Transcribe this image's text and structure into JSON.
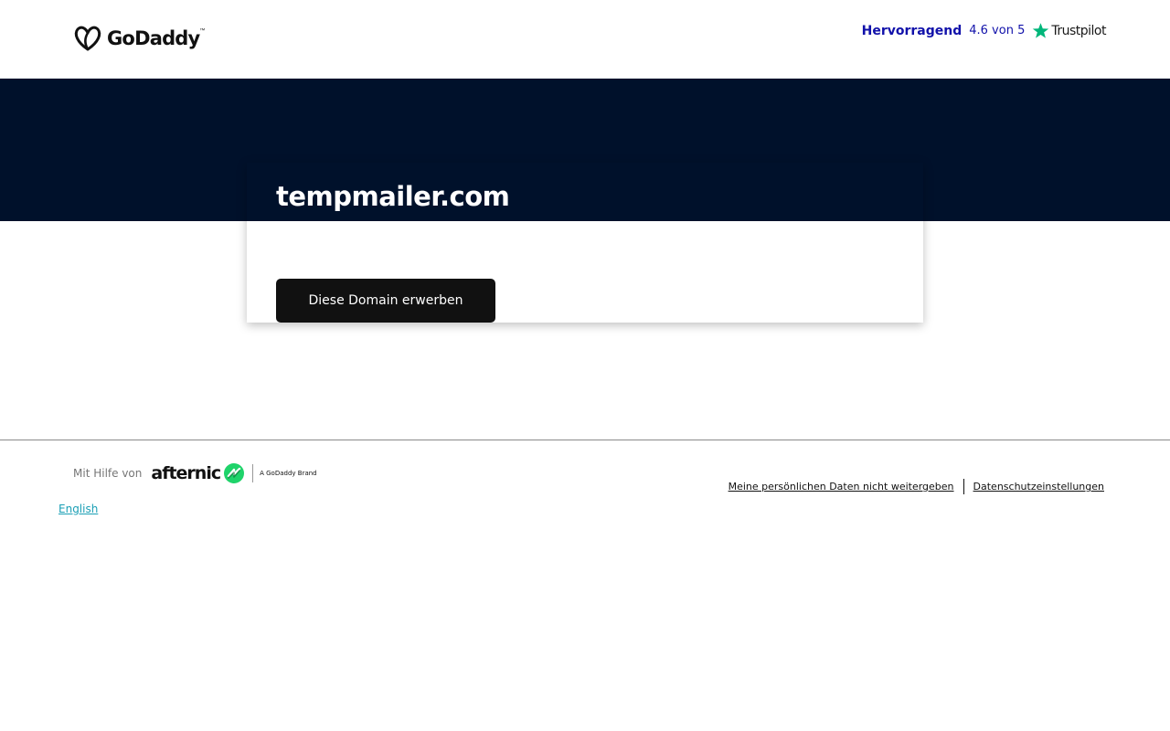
{
  "header": {
    "logo_text": "GoDaddy",
    "logo_tm": "™",
    "trustpilot": {
      "rating_label": "Hervorragend",
      "score_text": "4.6 von 5",
      "brand": "Trustpilot",
      "star_color": "#00b67a"
    }
  },
  "hero": {
    "background_color": "#00112b",
    "domain": "tempmailer.com",
    "buy_button_label": "Diese Domain erwerben"
  },
  "footer": {
    "powered_by_label": "Mit Hilfe von",
    "partner_name": "afternic",
    "partner_tagline": "A GoDaddy Brand",
    "partner_accent_color": "#1fd36a",
    "language_link": "English",
    "links": [
      "Meine persönlichen Daten nicht weitergeben",
      "Datenschutzeinstellungen"
    ]
  }
}
